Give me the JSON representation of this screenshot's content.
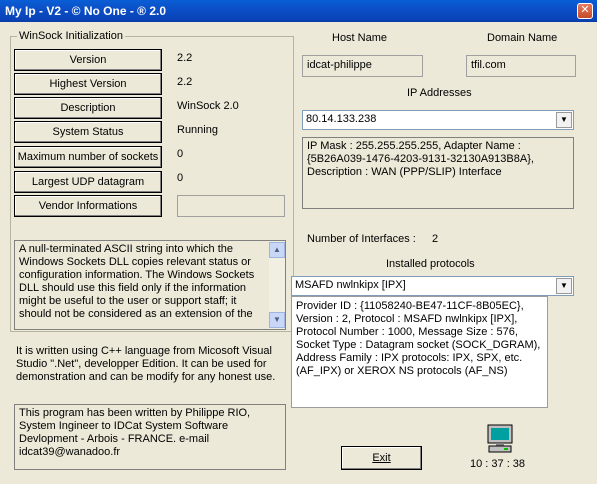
{
  "window": {
    "title": "My Ip - V2 - © No One - ® 2.0",
    "close_glyph": "✕"
  },
  "winsock": {
    "group_title": "WinSock Initialization",
    "rows": [
      {
        "label": "Version",
        "value": "2.2"
      },
      {
        "label": "Highest Version",
        "value": "2.2"
      },
      {
        "label": "Description",
        "value": "WinSock 2.0"
      },
      {
        "label": "System Status",
        "value": "Running"
      },
      {
        "label": "Maximum number of sockets",
        "value": "0"
      },
      {
        "label": "Largest UDP  datagram",
        "value": "0"
      },
      {
        "label": "Vendor Informations",
        "value": ""
      }
    ],
    "vendor_text": "A null-terminated ASCII string into which the Windows Sockets DLL copies relevant status or configuration information. The Windows Sockets DLL should use this field only if the information might be useful to the user or support staff; it should not be considered as an extension of the"
  },
  "about_text": "It is written using C++ language from Micosoft Visual Studio \".Net\", developper Edition. It can be used for demonstration and can be modify for any honest use.",
  "author_text": "This program has been written by Philippe RIO, System Ingineer to IDCat System Software Devlopment - Arbois - FRANCE. e-mail idcat39@wanadoo.fr",
  "host": {
    "label": "Host Name",
    "value": "idcat-philippe"
  },
  "domain": {
    "label": "Domain Name",
    "value": "tfil.com"
  },
  "ip": {
    "label": "IP Addresses",
    "selected": "80.14.133.238",
    "details": "IP Mask : 255.255.255.255, Adapter Name : {5B26A039-1476-4203-9131-32130A913B8A}, Description : WAN (PPP/SLIP) Interface"
  },
  "interfaces": {
    "label": "Number of Interfaces :",
    "value": "2"
  },
  "protocols": {
    "label": "Installed protocols",
    "selected": "MSAFD nwlnkipx [IPX]",
    "details": "Provider ID : {11058240-BE47-11CF-8B05EC}, Version : 2, Protocol : MSAFD nwlnkipx [IPX], Protocol Number : 1000, Message Size : 576, Socket Type : Datagram socket (SOCK_DGRAM), Address Family : IPX protocols: IPX, SPX, etc. (AF_IPX) or XEROX NS protocols (AF_NS)"
  },
  "exit_label": "Exit",
  "clock": "10 : 37 : 38",
  "icons": {
    "computer": "computer-icon",
    "arrow": "▼",
    "up": "▲",
    "down": "▼"
  }
}
